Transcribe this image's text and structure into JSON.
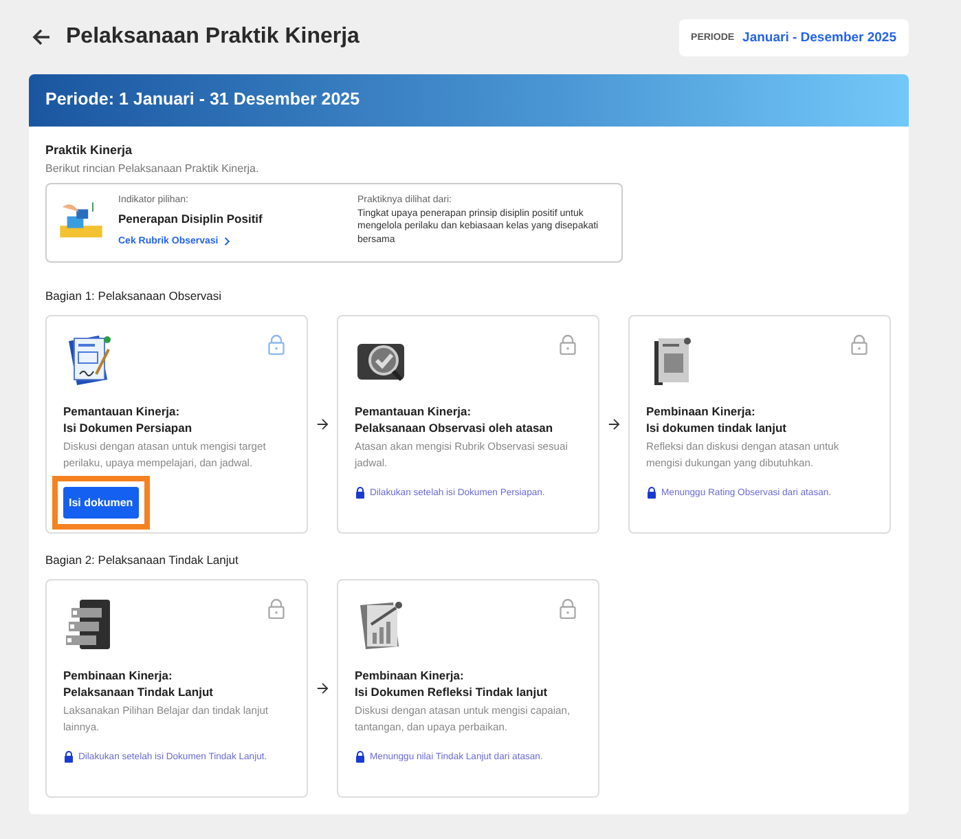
{
  "header": {
    "title": "Pelaksanaan Praktik Kinerja",
    "period_label": "PERIODE",
    "period_value": "Januari - Desember 2025"
  },
  "banner": {
    "title": "Periode: 1 Januari - 31 Desember 2025"
  },
  "intro": {
    "title": "Praktik Kinerja",
    "subtitle": "Berikut rincian Pelaksanaan Praktik Kinerja."
  },
  "indicator": {
    "label": "Indikator pilihan:",
    "name": "Penerapan Disiplin Positif",
    "link": "Cek Rubrik Observasi",
    "seen_label": "Praktiknya dilihat dari:",
    "seen_text": "Tingkat upaya penerapan prinsip disiplin positif untuk mengelola perilaku dan kebiasaan kelas yang disepakati bersama"
  },
  "sections": [
    {
      "title": "Bagian 1: Pelaksanaan Observasi",
      "cards": [
        {
          "kind": "document",
          "locked": false,
          "title": "Pemantauan Kinerja:",
          "subtitle": "Isi Dokumen Persiapan",
          "text": "Diskusi dengan atasan untuk mengisi target perilaku, upaya mempelajari, dan jadwal.",
          "button": {
            "label": "Isi dokumen",
            "highlighted": true
          }
        },
        {
          "kind": "magnifier",
          "locked": true,
          "title": "Pemantauan Kinerja:",
          "subtitle": "Pelaksanaan Observasi oleh atasan",
          "text": "Atasan akan mengisi Rubrik Observasi sesuai jadwal.",
          "note": "Dilakukan setelah isi Dokumen Persiapan."
        },
        {
          "kind": "report",
          "locked": true,
          "title": "Pembinaan Kinerja:",
          "subtitle": "Isi dokumen tindak lanjut",
          "text": "Refleksi dan diskusi dengan atasan untuk mengisi dukungan yang dibutuhkan.",
          "note": "Menunggu Rating Observasi dari atasan."
        }
      ]
    },
    {
      "title": "Bagian 2: Pelaksanaan Tindak Lanjut",
      "cards": [
        {
          "kind": "checklist",
          "locked": true,
          "title": "Pembinaan Kinerja:",
          "subtitle": "Pelaksanaan Tindak Lanjut",
          "text": "Laksanakan Pilihan Belajar dan tindak lanjut lainnya.",
          "note": "Dilakukan setelah isi Dokumen Tindak Lanjut."
        },
        {
          "kind": "chart",
          "locked": true,
          "title": "Pembinaan Kinerja:",
          "subtitle": "Isi Dokumen Refleksi Tindak lanjut",
          "text": "Diskusi dengan atasan untuk mengisi capaian, tantangan, dan upaya perbaikan.",
          "note": "Menunggu nilai Tindak Lanjut dari atasan."
        }
      ]
    }
  ]
}
